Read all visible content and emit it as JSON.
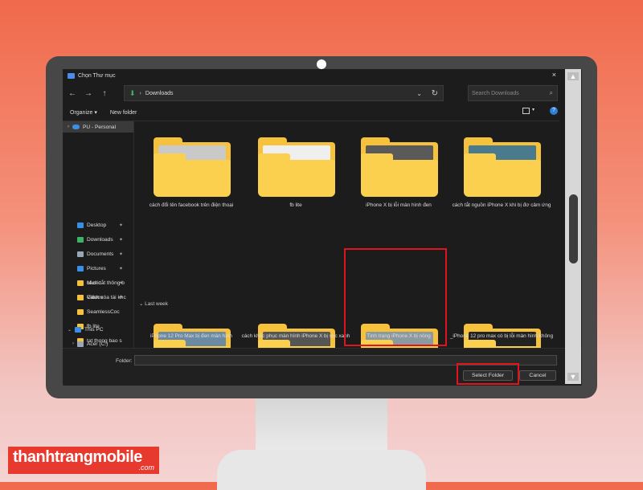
{
  "dialog": {
    "title": "Chọn Thư mục",
    "close_icon": "×"
  },
  "nav": {
    "back": "←",
    "forward": "→",
    "up": "↑",
    "path_sep": "›",
    "path": "Downloads",
    "path_chevron": "⌄",
    "refresh": "↻",
    "search_placeholder": "Search Downloads"
  },
  "toolbar": {
    "organize": "Organize ▾",
    "new_folder": "New folder",
    "view_chev": "▾",
    "help": "?"
  },
  "sidebar": {
    "personal": "PU - Personal",
    "items": [
      {
        "label": "Desktop",
        "color": "#3a8ee6"
      },
      {
        "label": "Downloads",
        "color": "#3fb26a"
      },
      {
        "label": "Documents",
        "color": "#9aa7b8"
      },
      {
        "label": "Pictures",
        "color": "#3a8ee6"
      },
      {
        "label": "Music",
        "color": "#e35d4c"
      },
      {
        "label": "Videos",
        "color": "#8a5be8"
      },
      {
        "label": "SeamlessCoc",
        "color": "#f6c13b"
      },
      {
        "label": "fb lite",
        "color": "#f6c13b"
      },
      {
        "label": "tat thong bao s",
        "color": "#f6c13b"
      },
      {
        "label": "cách tắt thông b",
        "color": "#f6c13b"
      },
      {
        "label": "Cách xóa tài khc",
        "color": "#f6c13b"
      }
    ],
    "pin_icon": "📌",
    "this_pc": "This PC",
    "acer": "Acer (C:)"
  },
  "content": {
    "group_last_week": "Last week",
    "folders_row1": [
      {
        "label": "cách đổi tên facebook trên điện thoại",
        "thumb": "#c9c9c9"
      },
      {
        "label": "fb lite",
        "thumb": "#efefef"
      },
      {
        "label": "iPhone X bị lỗi màn hình đen",
        "thumb": "#5a5a5a"
      },
      {
        "label": "cách tắt nguồn iPhone X khi bị đơ cảm ứng",
        "thumb": "#4a7a8e"
      }
    ],
    "folders_row2": [
      {
        "label": "iPhone 12 Pro Max bị đen màn hình",
        "thumb": "#6d8aa5"
      },
      {
        "label": "cách khắc phục màn hình iPhone X bị sọc xanh",
        "thumb": "#555555"
      },
      {
        "label": "Tình trạng iPhone X bị nóng",
        "thumb": "#8a9aa0"
      },
      {
        "label": "_iPhone 12 pro max có bị lỗi màn hình không",
        "thumb": "#222222"
      }
    ],
    "thumb_caption": "iPhone 12 pro max có bị lỗi màn hình không?"
  },
  "bottom": {
    "folder_label": "Folder:",
    "folder_value": "",
    "select_button": "Select Folder",
    "cancel_button": "Cancel"
  },
  "logo": {
    "text": "thanhtrangmobile",
    "domain": ".com"
  },
  "colors": {
    "highlight": "#e0141e",
    "accent": "#2f7fd8"
  }
}
